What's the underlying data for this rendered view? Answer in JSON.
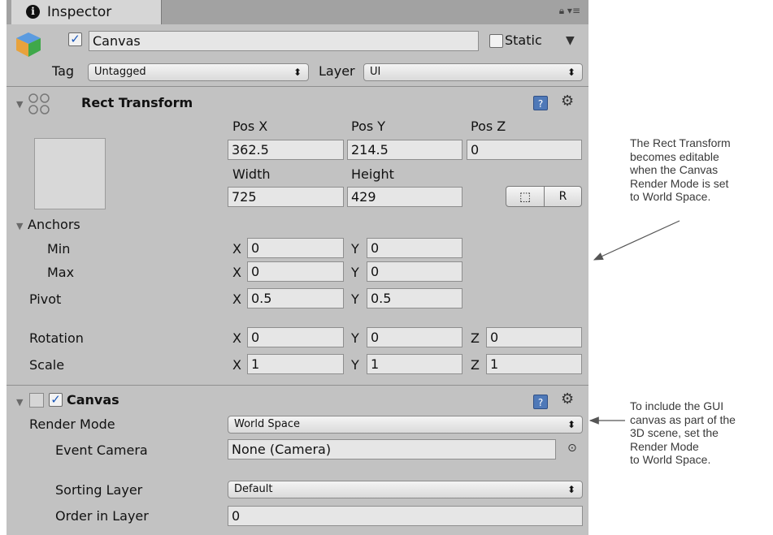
{
  "inspector": {
    "tab_label": "Inspector",
    "tab_icon": "info-icon",
    "object_name": "Canvas",
    "static_label": "Static",
    "tag_label": "Tag",
    "tag_value": "Untagged",
    "layer_label": "Layer",
    "layer_value": "UI"
  },
  "rect_transform": {
    "title": "Rect Transform",
    "pos_x_label": "Pos X",
    "pos_y_label": "Pos Y",
    "pos_z_label": "Pos Z",
    "pos_x": "362.5",
    "pos_y": "214.5",
    "pos_z": "0",
    "width_label": "Width",
    "height_label": "Height",
    "width": "725",
    "height": "429",
    "blueprint_button": "⬚",
    "raw_button": "R",
    "anchors_label": "Anchors",
    "min_label": "Min",
    "max_label": "Max",
    "min_x": "0",
    "min_y": "0",
    "max_x": "0",
    "max_y": "0",
    "pivot_label": "Pivot",
    "pivot_x": "0.5",
    "pivot_y": "0.5",
    "rotation_label": "Rotation",
    "rot_x": "0",
    "rot_y": "0",
    "rot_z": "0",
    "scale_label": "Scale",
    "scale_x": "1",
    "scale_y": "1",
    "scale_z": "1",
    "axis_x": "X",
    "axis_y": "Y",
    "axis_z": "Z"
  },
  "canvas_component": {
    "title": "Canvas",
    "render_mode_label": "Render Mode",
    "render_mode_value": "World Space",
    "event_camera_label": "Event Camera",
    "event_camera_value": "None (Camera)",
    "sorting_layer_label": "Sorting Layer",
    "sorting_layer_value": "Default",
    "order_label": "Order in Layer",
    "order_value": "0"
  },
  "annotations": {
    "top": [
      "The Rect Transform",
      "becomes editable",
      "when the Canvas",
      "Render Mode is set",
      "to World Space."
    ],
    "bottom": [
      "To include the GUI",
      "canvas as part of the",
      "3D scene, set the",
      "Render Mode",
      "to World Space."
    ]
  },
  "colors": {
    "panel_bg": "#c2c2c2",
    "field_bg": "#e6e6e6",
    "checkbox_check": "#1b57b8",
    "help_icon": "#4f79b8"
  }
}
